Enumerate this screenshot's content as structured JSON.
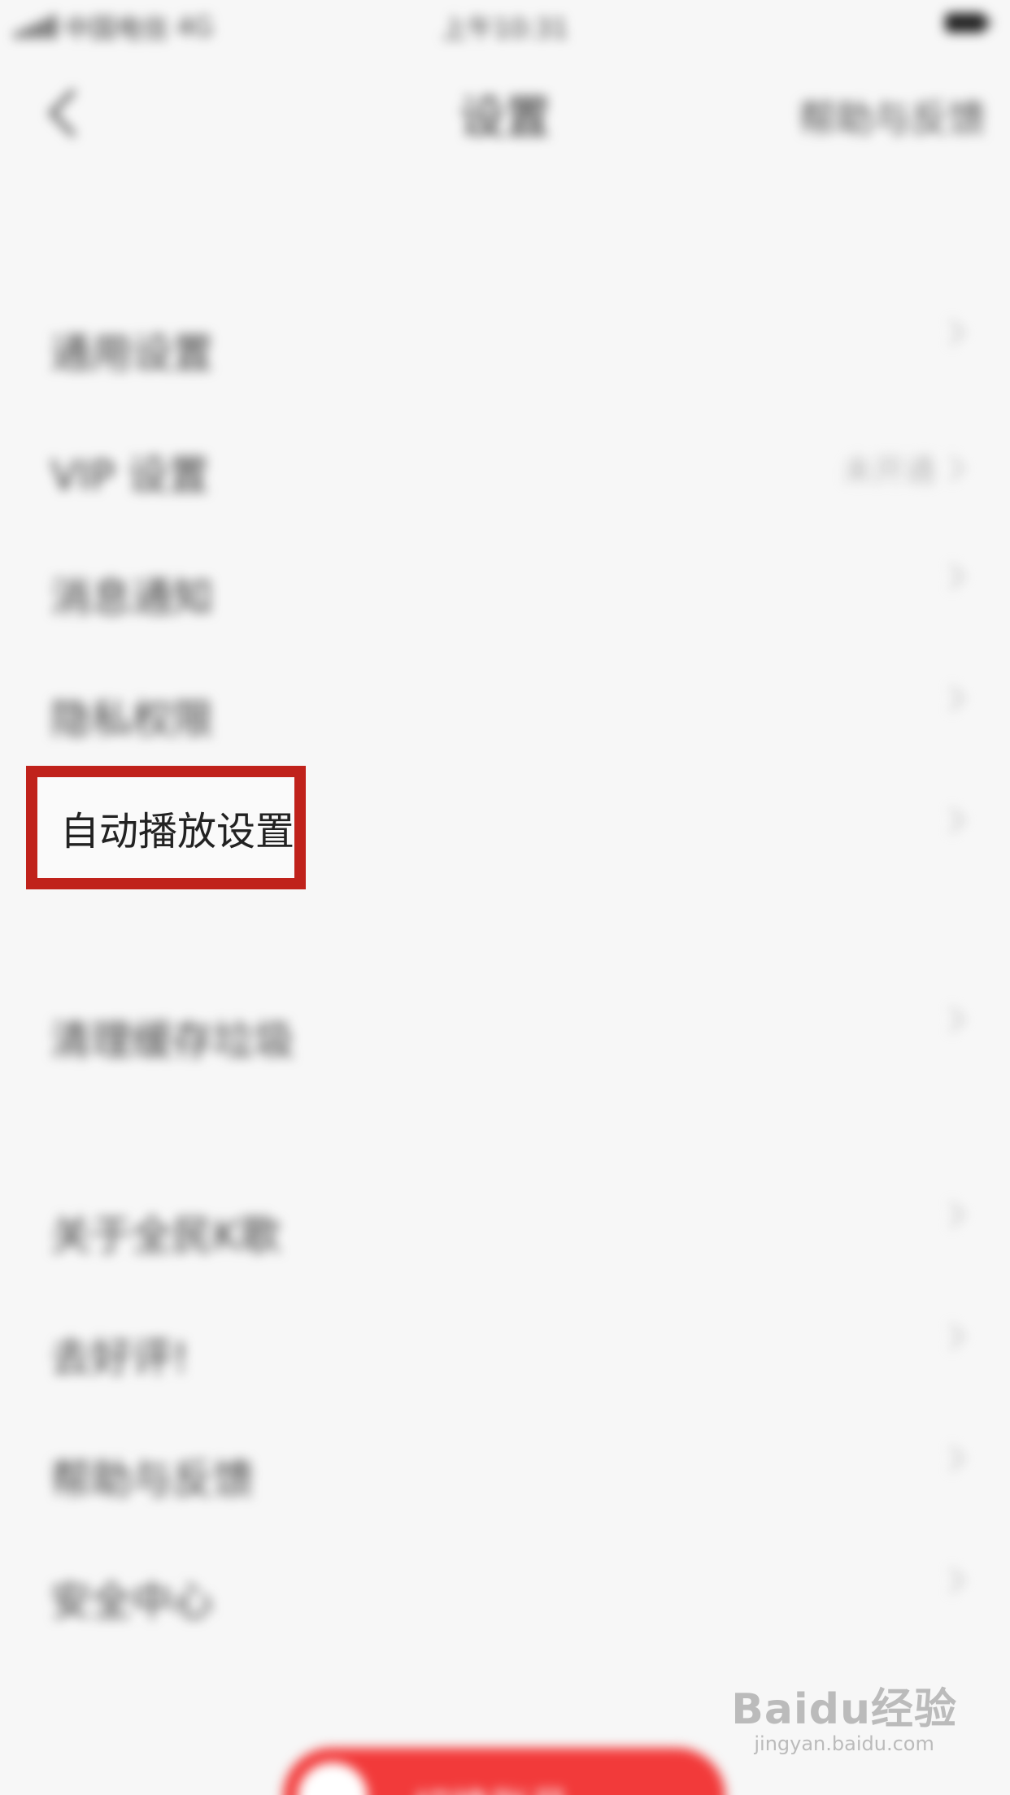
{
  "status_bar": {
    "carrier": "中国电信",
    "network": "4G",
    "time": "上午10:31"
  },
  "nav": {
    "title": "设置",
    "help_label": "帮助与反馈"
  },
  "settings": {
    "general": "通用设置",
    "vip": "VIP 设置",
    "vip_status": "未开通",
    "notifications": "消息通知",
    "privacy": "隐私权限",
    "autoplay": "自动播放设置",
    "clear_cache": "清理缓存垃圾",
    "about": "关于全民K歌",
    "rate": "去好评!",
    "help": "帮助与反馈",
    "security": "安全中心"
  },
  "bottom_button": {
    "label": "切换账号"
  },
  "watermark": {
    "logo": "Baidu经验",
    "url": "jingyan.baidu.com"
  },
  "colors": {
    "highlight_border": "#c0221b",
    "button_red": "#f23a3a",
    "background": "#f7f7f7"
  }
}
